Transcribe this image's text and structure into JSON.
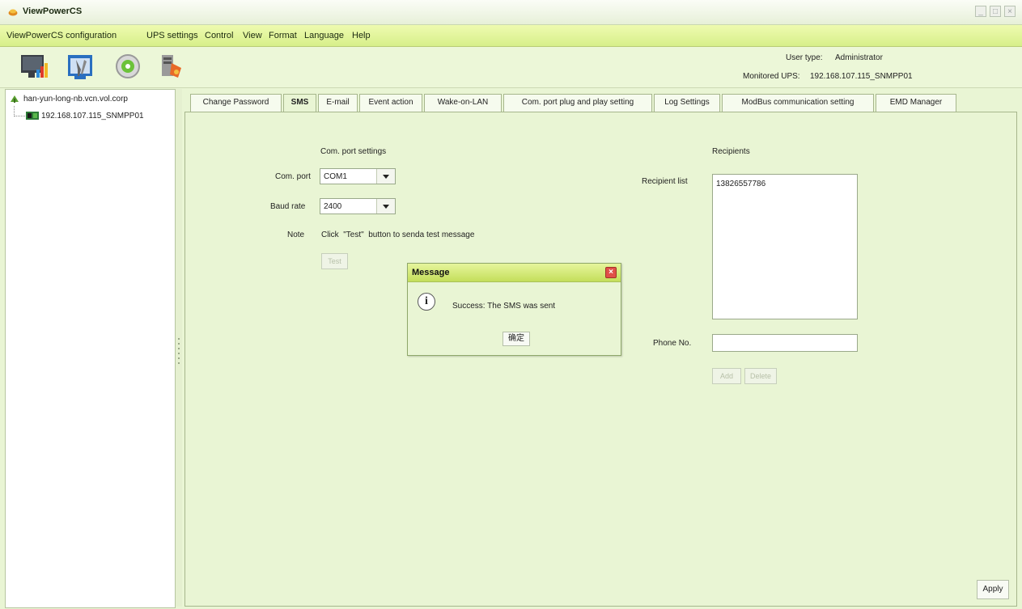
{
  "window": {
    "title": "ViewPowerCS"
  },
  "menu": [
    "ViewPowerCS configuration",
    "UPS settings",
    "Control",
    "View",
    "Format",
    "Language",
    "Help"
  ],
  "header_info": {
    "user_type_label": "User type:",
    "user_type_value": "Administrator",
    "monitored_label": "Monitored UPS:",
    "monitored_value": "192.168.107.115_SNMPP01"
  },
  "toolbar": [
    "monitor-chart-icon",
    "settings-tools-icon",
    "power-disc-icon",
    "database-icon"
  ],
  "tree": {
    "root": "han-yun-long-nb.vcn.vol.corp",
    "child": "192.168.107.115_SNMPP01"
  },
  "tabs": [
    "Change Password",
    "SMS",
    "E-mail",
    "Event action",
    "Wake-on-LAN",
    "Com. port plug and play setting",
    "Log Settings",
    "ModBus communication setting",
    "EMD Manager"
  ],
  "active_tab": "SMS",
  "sms": {
    "com_section": "Com. port settings",
    "com_port_label": "Com. port",
    "com_port_value": "COM1",
    "baud_label": "Baud rate",
    "baud_value": "2400",
    "note_label": "Note",
    "note_text": "Click  \"Test\"  button to senda test message",
    "test_button": "Test",
    "recipients_section": "Recipients",
    "recipient_list_label": "Recipient list",
    "recipients": [
      "13826557786"
    ],
    "phone_label": "Phone No.",
    "phone_value": "",
    "add_button": "Add",
    "delete_button": "Delete",
    "apply_button": "Apply"
  },
  "dialog": {
    "title": "Message",
    "message": "Success: The SMS was sent",
    "ok_button": "确定"
  }
}
